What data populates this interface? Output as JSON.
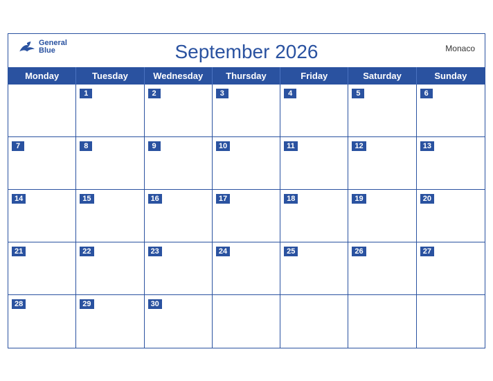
{
  "header": {
    "month_year": "September 2026",
    "country": "Monaco",
    "logo": {
      "line1": "General",
      "line2": "Blue"
    }
  },
  "days_of_week": [
    "Monday",
    "Tuesday",
    "Wednesday",
    "Thursday",
    "Friday",
    "Saturday",
    "Sunday"
  ],
  "weeks": [
    [
      null,
      1,
      2,
      3,
      4,
      5,
      6
    ],
    [
      7,
      8,
      9,
      10,
      11,
      12,
      13
    ],
    [
      14,
      15,
      16,
      17,
      18,
      19,
      20
    ],
    [
      21,
      22,
      23,
      24,
      25,
      26,
      27
    ],
    [
      28,
      29,
      30,
      null,
      null,
      null,
      null
    ]
  ]
}
